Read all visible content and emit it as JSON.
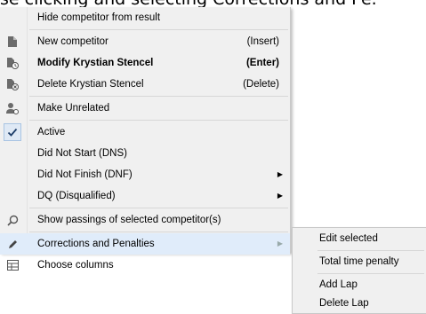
{
  "background_text": "se clicking and selecting Corrections and Pe.",
  "menu": {
    "items": [
      {
        "label": "Hide competitor from result",
        "shortcut": "",
        "icon": "",
        "bold": false
      },
      {
        "label": "New competitor",
        "shortcut": "(Insert)",
        "icon": "new-competitor-icon",
        "bold": false
      },
      {
        "label": "Modify Krystian Stencel",
        "shortcut": "(Enter)",
        "icon": "modify-competitor-icon",
        "bold": true
      },
      {
        "label": "Delete Krystian Stencel",
        "shortcut": "(Delete)",
        "icon": "delete-competitor-icon",
        "bold": false
      },
      {
        "label": "Make Unrelated",
        "shortcut": "",
        "icon": "unrelate-icon",
        "bold": false
      },
      {
        "label": "Active",
        "shortcut": "",
        "icon": "checkmark-icon",
        "bold": false
      },
      {
        "label": "Did Not Start (DNS)",
        "shortcut": "",
        "icon": "",
        "bold": false
      },
      {
        "label": "Did Not Finish (DNF)",
        "shortcut": "",
        "icon": "",
        "bold": false
      },
      {
        "label": "DQ (Disqualified)",
        "shortcut": "",
        "icon": "",
        "bold": false
      },
      {
        "label": "Show passings of selected competitor(s)",
        "shortcut": "",
        "icon": "search-icon",
        "bold": false
      },
      {
        "label": "Corrections and Penalties",
        "shortcut": "",
        "icon": "pencil-icon",
        "bold": false
      },
      {
        "label": "Choose columns",
        "shortcut": "",
        "icon": "columns-grid-icon",
        "bold": false
      }
    ],
    "submenu_arrow": "▶"
  },
  "submenu": {
    "items": [
      {
        "label": "Edit selected"
      },
      {
        "label": "Total time penalty"
      },
      {
        "label": "Add Lap"
      },
      {
        "label": "Delete Lap"
      }
    ]
  },
  "colors": {
    "menu_bg": "#f0f0f0",
    "highlight_bg": "#e0ecfa",
    "separator": "#d7d7d7"
  }
}
